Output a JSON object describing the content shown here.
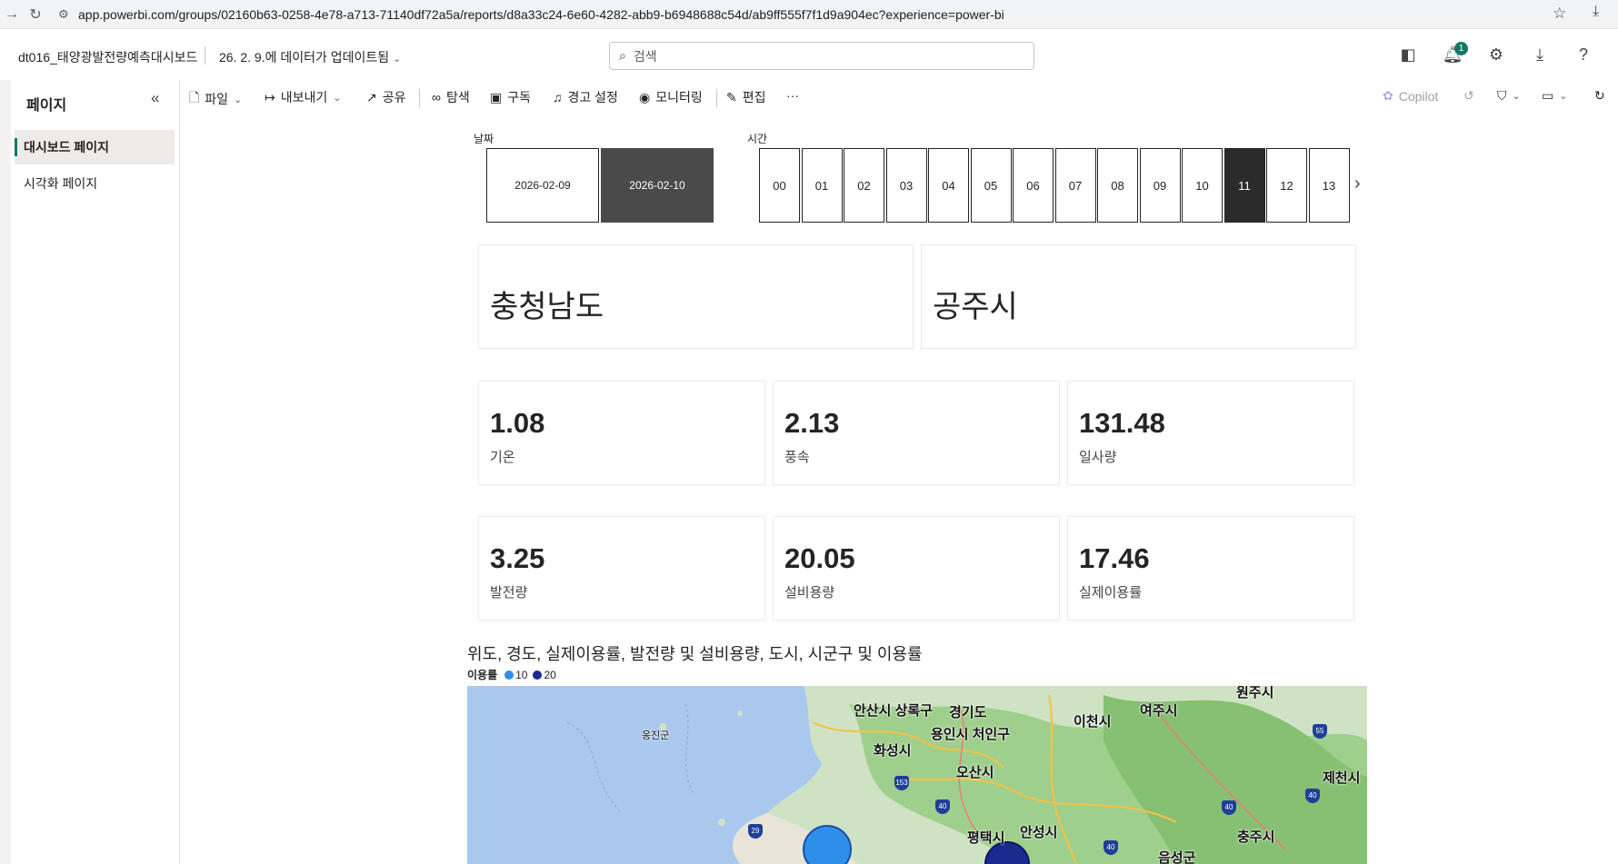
{
  "browser": {
    "url": "app.powerbi.com/groups/02160b63-0258-4e78-a713-71140df72a5a/reports/d8a33c24-6e60-4282-abb9-b6948688c54d/ab9ff555f7f1d9a904ec?experience=power-bi"
  },
  "header": {
    "report_name": "dt016_태양광발전량예측대시보드",
    "updated": "26. 2. 9.에 데이터가 업데이트됨",
    "search_placeholder": "검색",
    "notification_count": "1"
  },
  "pages_pane": {
    "title": "페이지",
    "items": [
      {
        "label": "대시보드 페이지",
        "active": true
      },
      {
        "label": "시각화 페이지",
        "active": false
      }
    ]
  },
  "actionbar": {
    "file": "파일",
    "export": "내보내기",
    "share": "공유",
    "explore": "탐색",
    "subscribe": "구독",
    "alerts": "경고 설정",
    "monitoring": "모니터링",
    "edit": "편집",
    "more": "···",
    "copilot": "Copilot"
  },
  "slicers": {
    "date_title": "날짜",
    "dates": [
      "2026-02-09",
      "2026-02-10"
    ],
    "date_selected": "2026-02-10",
    "time_title": "시간",
    "hours": [
      "00",
      "01",
      "02",
      "03",
      "04",
      "05",
      "06",
      "07",
      "08",
      "09",
      "10",
      "11",
      "12",
      "13"
    ],
    "hour_selected": "11"
  },
  "region": {
    "province": "충청남도",
    "city": "공주시"
  },
  "kpis": [
    {
      "value": "1.08",
      "label": "기온"
    },
    {
      "value": "2.13",
      "label": "풍속"
    },
    {
      "value": "131.48",
      "label": "일사량"
    },
    {
      "value": "3.25",
      "label": "발전량"
    },
    {
      "value": "20.05",
      "label": "설비용량"
    },
    {
      "value": "17.46",
      "label": "실제이용률"
    }
  ],
  "map": {
    "title": "위도, 경도, 실제이용률, 발전량 및 설비용량, 도시, 시군구 및 이용률",
    "legend_title": "이용률",
    "legend_items": [
      {
        "label": "10",
        "color": "#2f8fe8"
      },
      {
        "label": "20",
        "color": "#1a2a8f"
      }
    ],
    "labels": [
      {
        "text": "안산시 상록구"
      },
      {
        "text": "경기도"
      },
      {
        "text": "용인시 처인구"
      },
      {
        "text": "이천시"
      },
      {
        "text": "여주시"
      },
      {
        "text": "원주시"
      },
      {
        "text": "화성시"
      },
      {
        "text": "오산시"
      },
      {
        "text": "평택시"
      },
      {
        "text": "안성시"
      },
      {
        "text": "충주시"
      },
      {
        "text": "제천시"
      },
      {
        "text": "음성군"
      },
      {
        "text": "옹진군"
      }
    ],
    "highways": [
      "153",
      "40",
      "29",
      "55",
      "40",
      "40",
      "40"
    ]
  }
}
